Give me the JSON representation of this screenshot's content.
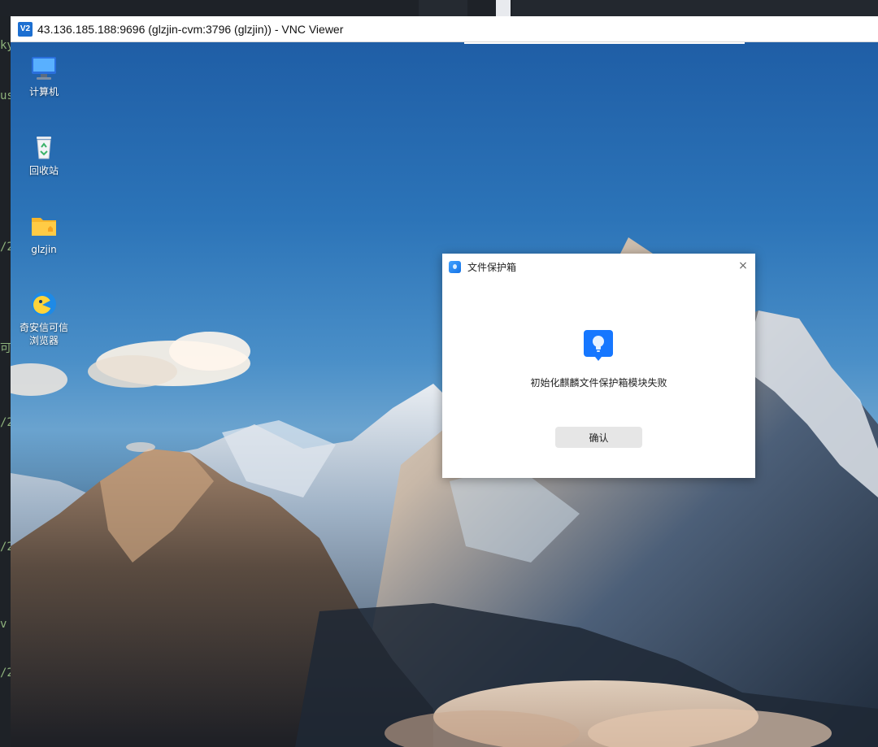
{
  "vnc": {
    "logo": "V2",
    "title": "43.136.185.188:9696 (glzjin-cvm:3796 (glzjin)) - VNC Viewer"
  },
  "host_left_fragments": [
    "ky",
    "us",
    "/2",
    "可",
    "/2",
    "/2",
    "v",
    "/2"
  ],
  "desktop_icons": [
    {
      "name": "computer-icon",
      "label": "计算机"
    },
    {
      "name": "recycle-bin-icon",
      "label": "回收站"
    },
    {
      "name": "folder-icon",
      "label": "glzjin"
    },
    {
      "name": "browser-icon",
      "label_lines": [
        "奇安信可信",
        "浏览器"
      ]
    }
  ],
  "dialog": {
    "title": "文件保护箱",
    "close": "×",
    "message": "初始化麒麟文件保护箱模块失败",
    "confirm_label": "确认",
    "accent": "#1677ff"
  }
}
